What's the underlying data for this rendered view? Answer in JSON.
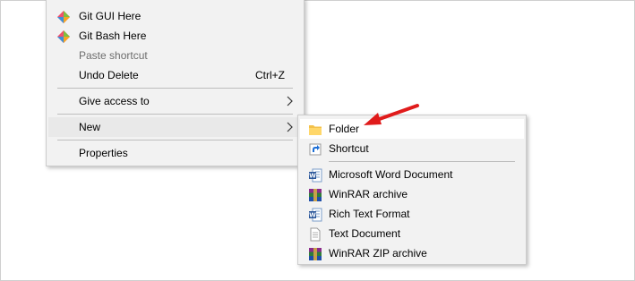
{
  "context_menu": {
    "items": [
      {
        "label": "Git GUI Here",
        "icon": "git-gui-icon"
      },
      {
        "label": "Git Bash Here",
        "icon": "git-bash-icon"
      },
      {
        "label": "Paste shortcut",
        "disabled": true
      },
      {
        "label": "Undo Delete",
        "shortcut": "Ctrl+Z"
      },
      {
        "label": "Give access to",
        "has_submenu": true
      },
      {
        "label": "New",
        "has_submenu": true,
        "highlighted": true
      },
      {
        "label": "Properties"
      }
    ]
  },
  "new_submenu": {
    "items": [
      {
        "label": "Folder",
        "icon": "folder-icon",
        "highlighted": true
      },
      {
        "label": "Shortcut",
        "icon": "shortcut-icon"
      },
      {
        "label": "Microsoft Word Document",
        "icon": "word-document-icon"
      },
      {
        "label": "WinRAR archive",
        "icon": "winrar-archive-icon"
      },
      {
        "label": "Rich Text Format",
        "icon": "rich-text-icon"
      },
      {
        "label": "Text Document",
        "icon": "text-document-icon"
      },
      {
        "label": "WinRAR ZIP archive",
        "icon": "winrar-zip-icon"
      }
    ]
  },
  "colors": {
    "menu_background": "#f2f2f2",
    "highlight": "#ffffff",
    "annotation_arrow": "#e01b1b",
    "disabled_text": "#6d6d6d"
  }
}
